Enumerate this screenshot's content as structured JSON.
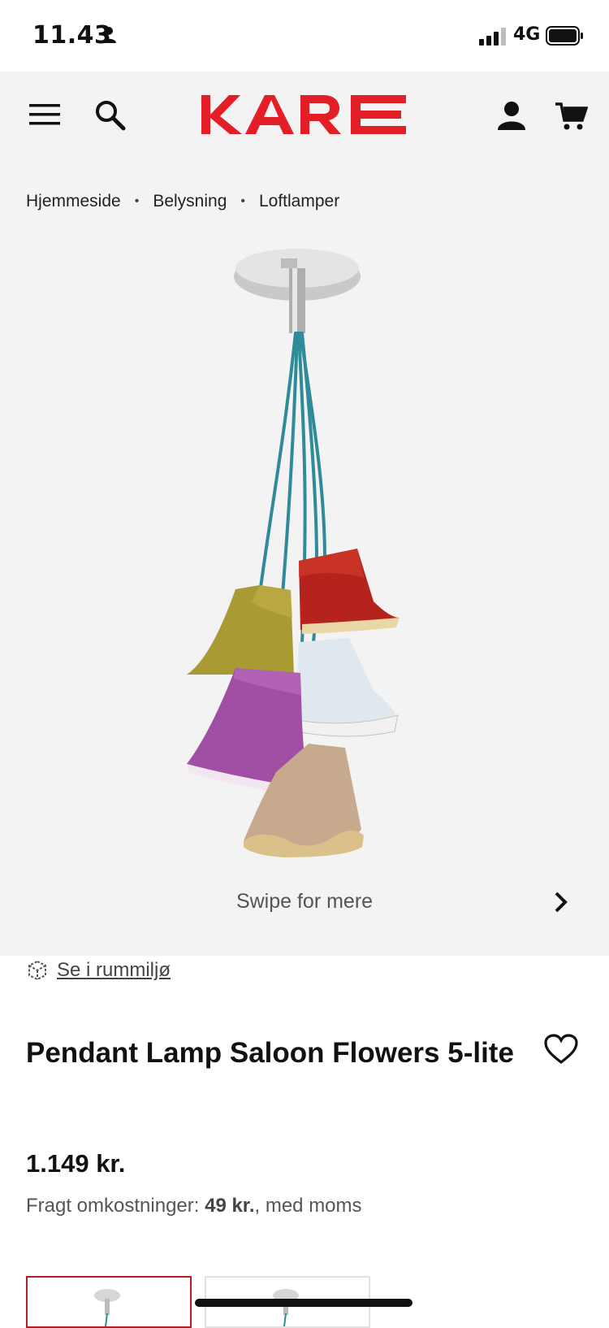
{
  "status_bar": {
    "time": "11.43",
    "network": "4G"
  },
  "header": {
    "brand": "KARE"
  },
  "breadcrumb": [
    "Hjemmeside",
    "Belysning",
    "Loftlamper"
  ],
  "gallery": {
    "swipe_hint": "Swipe for mere"
  },
  "room_view": {
    "label": "Se i rummiljø"
  },
  "product": {
    "title": "Pendant Lamp Saloon Flowers 5-lite",
    "price": "1.149 kr.",
    "shipping_prefix": "Fragt omkostninger: ",
    "shipping_amount": "49 kr.",
    "shipping_suffix": ", med moms"
  },
  "colors": {
    "brand": "#e41e26",
    "background": "#f3f3f3",
    "selected_thumb": "#b11f24"
  }
}
